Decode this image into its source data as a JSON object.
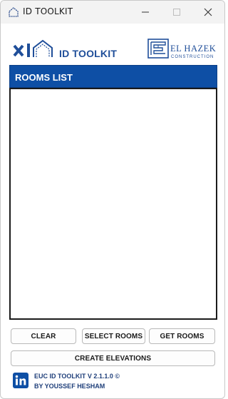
{
  "window": {
    "title": "ID TOOLKIT"
  },
  "header": {
    "app_name": "ID TOOLKIT",
    "company_name": "EL HAZEK",
    "company_subtitle": "CONSTRUCTION"
  },
  "rooms": {
    "header": "ROOMS LIST",
    "items": []
  },
  "buttons": {
    "clear": "CLEAR",
    "select_rooms": "SELECT ROOMS",
    "get_rooms": "GET ROOMS",
    "create_elevations": "CREATE ELEVATIONS"
  },
  "footer": {
    "version": "EUC ID TOOLKIT V 2.1.1.0 ©",
    "author": "BY YOUSSEF HESHAM"
  },
  "colors": {
    "accent": "#0e4fa5",
    "brand_text": "#1f4e99"
  }
}
